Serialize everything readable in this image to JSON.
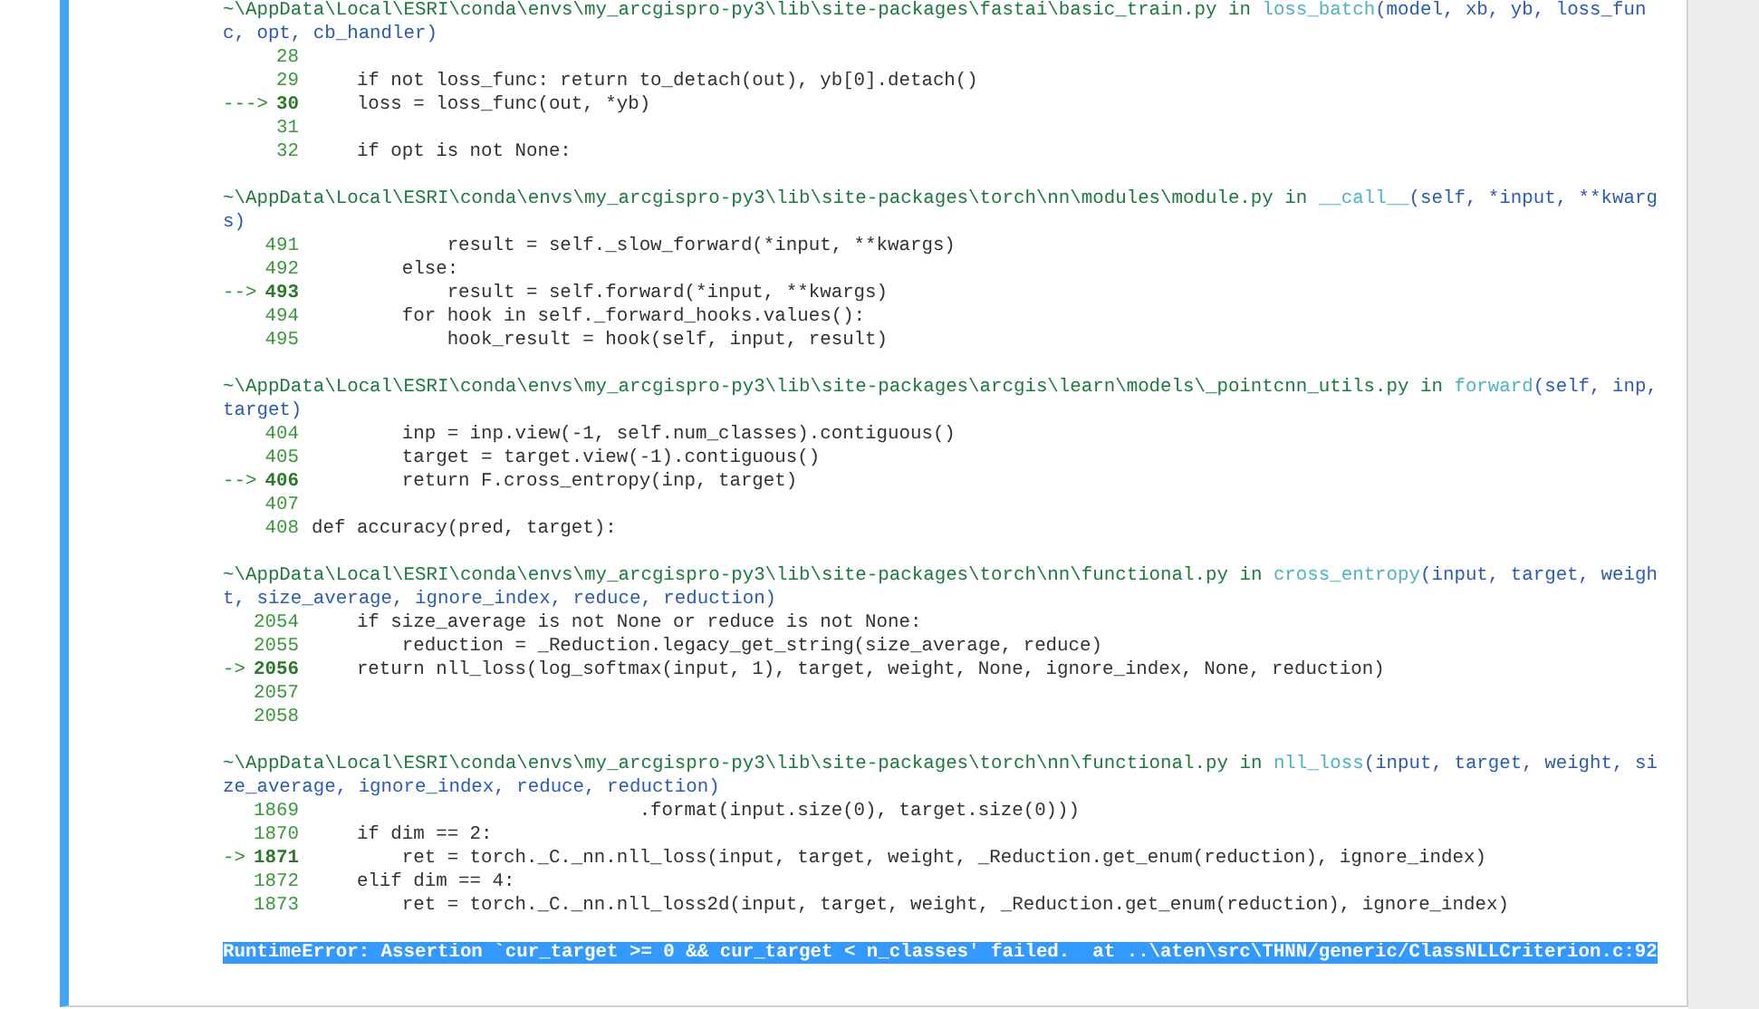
{
  "frames": [
    {
      "path": "~\\AppData\\Local\\ESRI\\conda\\envs\\my_arcgispro-py3\\lib\\site-packages\\fastai\\basic_train.py",
      "keyword": "in",
      "func": "loss_batch",
      "args": "(model, xb, yb, loss_func, opt, cb_handler)",
      "lines": [
        {
          "number": "28",
          "current": false
        },
        {
          "number": "29",
          "code": "    if not loss_func: return to_detach(out), yb[0].detach()",
          "current": false
        },
        {
          "marker": "--->",
          "number": "30",
          "code": "    loss = loss_func(out, *yb)",
          "current": true
        },
        {
          "number": "31",
          "current": false
        },
        {
          "number": "32",
          "code": "    if opt is not None:",
          "current": false
        }
      ]
    },
    {
      "path": "~\\AppData\\Local\\ESRI\\conda\\envs\\my_arcgispro-py3\\lib\\site-packages\\torch\\nn\\modules\\module.py",
      "keyword": "in",
      "func": "__call__",
      "args": "(self, *input, **kwargs)",
      "lines": [
        {
          "number": "491",
          "code": "            result = self._slow_forward(*input, **kwargs)",
          "current": false
        },
        {
          "number": "492",
          "code": "        else:",
          "current": false
        },
        {
          "marker": "-->",
          "number": "493",
          "code": "            result = self.forward(*input, **kwargs)",
          "current": true
        },
        {
          "number": "494",
          "code": "        for hook in self._forward_hooks.values():",
          "current": false
        },
        {
          "number": "495",
          "code": "            hook_result = hook(self, input, result)",
          "current": false
        }
      ]
    },
    {
      "path": "~\\AppData\\Local\\ESRI\\conda\\envs\\my_arcgispro-py3\\lib\\site-packages\\arcgis\\learn\\models\\_pointcnn_utils.py",
      "keyword": "in",
      "func": "forward",
      "args": "(self, inp, target)",
      "lines": [
        {
          "number": "404",
          "code": "        inp = inp.view(-1, self.num_classes).contiguous()",
          "current": false
        },
        {
          "number": "405",
          "code": "        target = target.view(-1).contiguous()",
          "current": false
        },
        {
          "marker": "-->",
          "number": "406",
          "code": "        return F.cross_entropy(inp, target)",
          "current": true
        },
        {
          "number": "407",
          "current": false
        },
        {
          "number": "408",
          "code": "def accuracy(pred, target):",
          "current": false
        }
      ]
    },
    {
      "path": "~\\AppData\\Local\\ESRI\\conda\\envs\\my_arcgispro-py3\\lib\\site-packages\\torch\\nn\\functional.py",
      "keyword": "in",
      "func": "cross_entropy",
      "args": "(input, target, weight, size_average, ignore_index, reduce, reduction)",
      "lines": [
        {
          "number": "2054",
          "code": "    if size_average is not None or reduce is not None:",
          "current": false
        },
        {
          "number": "2055",
          "code": "        reduction = _Reduction.legacy_get_string(size_average, reduce)",
          "current": false
        },
        {
          "marker": "->",
          "number": "2056",
          "code": "    return nll_loss(log_softmax(input, 1), target, weight, None, ignore_index, None, reduction)",
          "current": true
        },
        {
          "number": "2057",
          "current": false
        },
        {
          "number": "2058",
          "current": false
        }
      ]
    },
    {
      "path": "~\\AppData\\Local\\ESRI\\conda\\envs\\my_arcgispro-py3\\lib\\site-packages\\torch\\nn\\functional.py",
      "keyword": "in",
      "func": "nll_loss",
      "args": "(input, target, weight, size_average, ignore_index, reduce, reduction)",
      "lines": [
        {
          "number": "1869",
          "code": "                             .format(input.size(0), target.size(0)))",
          "current": false
        },
        {
          "number": "1870",
          "code": "    if dim == 2:",
          "current": false
        },
        {
          "marker": "->",
          "number": "1871",
          "code": "        ret = torch._C._nn.nll_loss(input, target, weight, _Reduction.get_enum(reduction), ignore_index)",
          "current": true
        },
        {
          "number": "1872",
          "code": "    elif dim == 4:",
          "current": false
        },
        {
          "number": "1873",
          "code": "        ret = torch._C._nn.nll_loss2d(input, target, weight, _Reduction.get_enum(reduction), ignore_index)",
          "current": false
        }
      ]
    }
  ],
  "error": {
    "text": "RuntimeError: Assertion `cur_target >= 0 && cur_target < n_classes' failed.  at ..\\aten\\src\\THNN/generic/ClassNLLCriterion.c:92",
    "selected": true
  }
}
